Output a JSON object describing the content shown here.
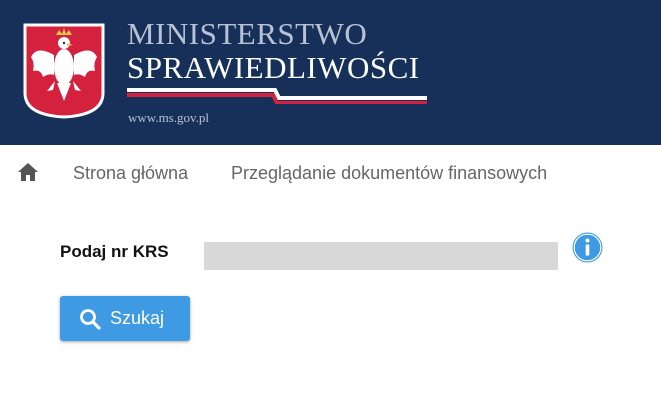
{
  "header": {
    "ministry_line1": "MINISTERSTWO",
    "ministry_line2": "SPRAWIEDLIWOŚCI",
    "url": "www.ms.gov.pl",
    "emblem_icon": "polish-eagle-emblem-icon",
    "background_color": "#16305a",
    "emblem_red": "#d4213d"
  },
  "breadcrumb": {
    "home_icon": "home-icon",
    "items": [
      {
        "label": "Strona główna"
      },
      {
        "label": "Przeglądanie dokumentów finansowych"
      }
    ]
  },
  "form": {
    "krs_label": "Podaj nr KRS",
    "krs_value": "",
    "info_icon": "info-icon",
    "search_button_label": "Szukaj",
    "search_icon": "search-icon",
    "accent_color": "#3e9ae2"
  }
}
